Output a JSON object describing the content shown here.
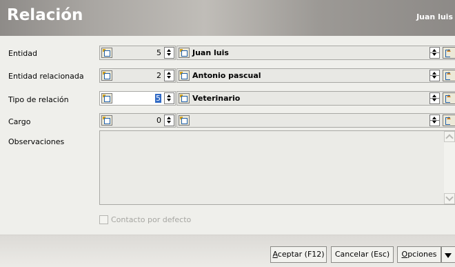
{
  "header": {
    "title": "Relación",
    "user": "Juan luis"
  },
  "fields": {
    "entidad": {
      "label": "Entidad",
      "code": "5",
      "name": "Juan luis"
    },
    "entidad_relacionada": {
      "label": "Entidad relacionada",
      "code": "2",
      "name": "Antonio pascual"
    },
    "tipo_relacion": {
      "label": "Tipo de relación",
      "code": "5",
      "name": "Veterinario"
    },
    "cargo": {
      "label": "Cargo",
      "code": "0",
      "name": ""
    },
    "observaciones": {
      "label": "Observaciones",
      "value": ""
    }
  },
  "checkbox": {
    "label": "Contacto por defecto",
    "checked": false
  },
  "footer": {
    "accept_accesskey": "A",
    "accept_rest": "ceptar (F12)",
    "cancel_label": "Cancelar (Esc)",
    "options_accesskey": "O",
    "options_rest": "pciones"
  },
  "colors": {
    "selection": "#316ac5",
    "header_text": "#ffffff",
    "disabled_text": "#a6a6a2"
  }
}
